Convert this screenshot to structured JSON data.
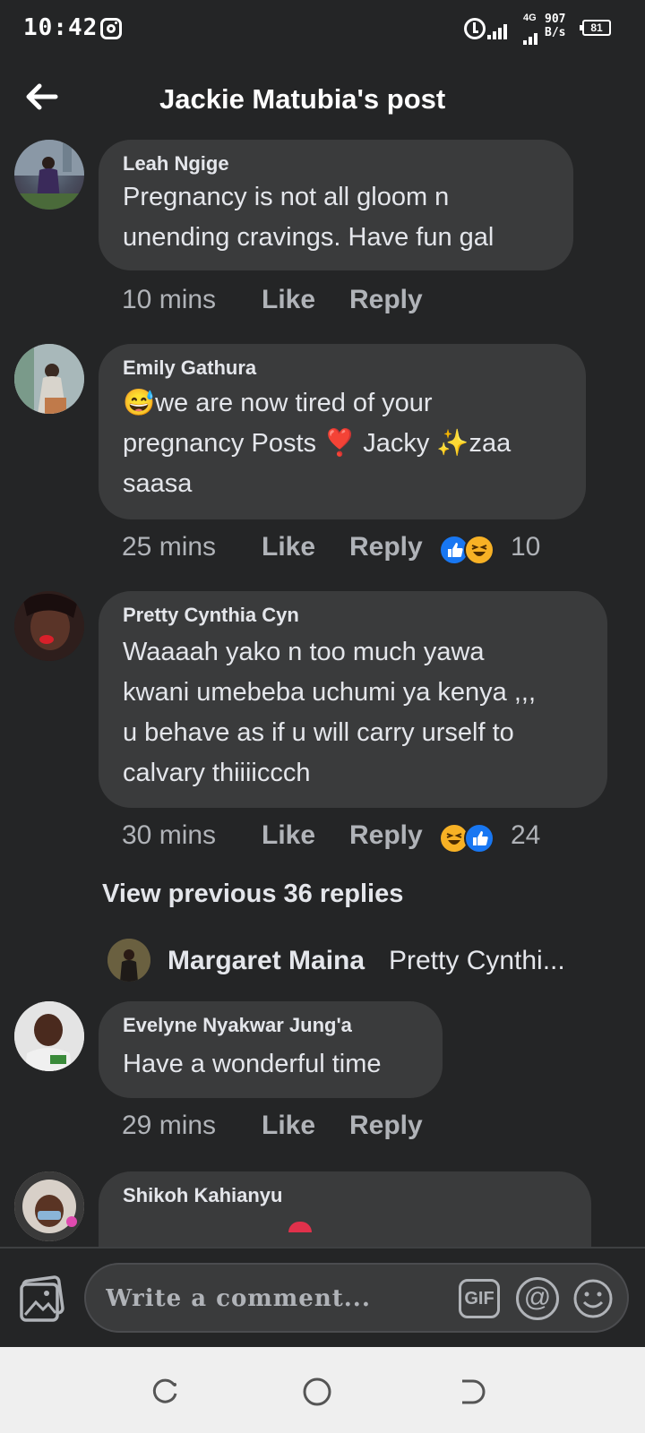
{
  "status_bar": {
    "time": "10:42",
    "network_type": "4G",
    "net_speed_value": "907",
    "net_speed_unit": "B/s",
    "battery": "81"
  },
  "header": {
    "title": "Jackie Matubia's post"
  },
  "comments": [
    {
      "author": "Leah Ngige",
      "lines": [
        "Pregnancy is not all gloom n",
        "unending cravings.  Have fun gal"
      ],
      "time": "10 mins",
      "like_label": "Like",
      "reply_label": "Reply"
    },
    {
      "author": "Emily Gathura",
      "lines": [
        "😅we are now tired of your",
        "pregnancy Posts ❣️ Jacky ✨zaa",
        "saasa"
      ],
      "time": "25 mins",
      "like_label": "Like",
      "reply_label": "Reply",
      "reaction_count": "10"
    },
    {
      "author": "Pretty Cynthia Cyn",
      "lines": [
        "Waaaah yako n too much yawa",
        "kwani umebeba uchumi ya kenya ,,,",
        "u behave as if u will carry urself to",
        "calvary thiiiiccch"
      ],
      "time": "30 mins",
      "like_label": "Like",
      "reply_label": "Reply",
      "reaction_count": "24"
    },
    {
      "author": "Evelyne Nyakwar Jung'a",
      "lines": [
        "Have a wonderful time"
      ],
      "time": "29 mins",
      "like_label": "Like",
      "reply_label": "Reply"
    },
    {
      "author": "Shikoh Kahianyu",
      "lines": []
    }
  ],
  "view_previous": "View previous 36 replies",
  "reply_preview": {
    "author": "Margaret Maina",
    "text": "Pretty Cynthi..."
  },
  "composer": {
    "placeholder": "Write a comment...",
    "gif_label": "GIF",
    "at_label": "@"
  },
  "colors": {
    "background": "#242526",
    "bubble": "#3a3b3c",
    "like_blue": "#1877f2",
    "haha_yellow": "#f7b125"
  }
}
